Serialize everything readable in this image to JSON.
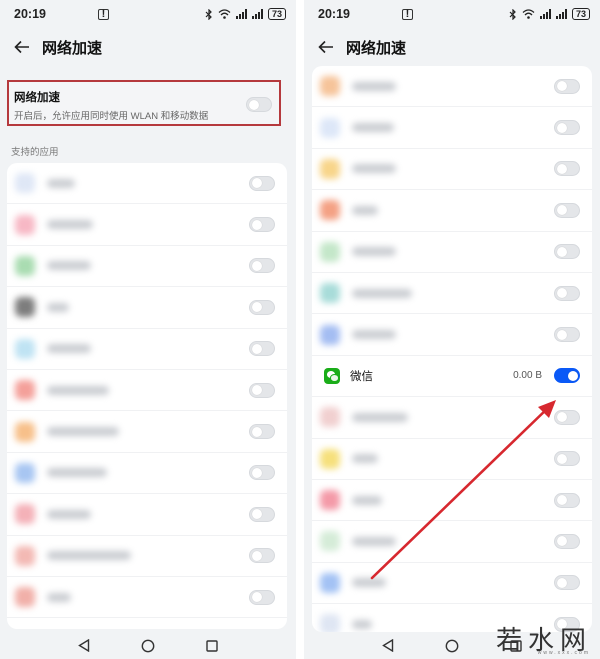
{
  "status_bar": {
    "time": "20:19",
    "battery": "73"
  },
  "screen_title": "网络加速",
  "accel_card": {
    "title": "网络加速",
    "subtitle": "开启后，允许应用同时使用 WLAN 和移动数据"
  },
  "section_label": "支持的应用",
  "left_apps": [
    {
      "icon_color": "#dfe7f6",
      "name_width": 28
    },
    {
      "icon_color": "#f7b8c5",
      "name_width": 46
    },
    {
      "icon_color": "#a9dcb1",
      "name_width": 44
    },
    {
      "icon_color": "#7d7d7d",
      "name_width": 22
    },
    {
      "icon_color": "#bfe3f3",
      "name_width": 44
    },
    {
      "icon_color": "#f4a09a",
      "name_width": 62
    },
    {
      "icon_color": "#f7c08a",
      "name_width": 72
    },
    {
      "icon_color": "#a8c6f2",
      "name_width": 60
    },
    {
      "icon_color": "#f4b1b8",
      "name_width": 44
    },
    {
      "icon_color": "#f3b9b4",
      "name_width": 84
    },
    {
      "icon_color": "#f1b0a9",
      "name_width": 24
    }
  ],
  "right_apps": [
    {
      "icon_color": "#f6c49a",
      "name_width": 44
    },
    {
      "icon_color": "#dde7f8",
      "name_width": 42
    },
    {
      "icon_color": "#f8d58a",
      "name_width": 44
    },
    {
      "icon_color": "#f4a184",
      "name_width": 26
    },
    {
      "icon_color": "#c4e7c9",
      "name_width": 44
    },
    {
      "icon_color": "#a8dcd9",
      "name_width": 60
    },
    {
      "icon_color": "#a4bdf2",
      "name_width": 44
    }
  ],
  "wechat_row": {
    "name": "微信",
    "size": "0.00 B",
    "enabled": true
  },
  "right_apps_after": [
    {
      "icon_color": "#f1d0d0",
      "name_width": 56
    },
    {
      "icon_color": "#f6e07c",
      "name_width": 26
    },
    {
      "icon_color": "#f49aa8",
      "name_width": 30
    },
    {
      "icon_color": "#d5ecd8",
      "name_width": 44
    },
    {
      "icon_color": "#a3c2f4",
      "name_width": 34
    },
    {
      "icon_color": "#dfe6f3",
      "name_width": 20
    }
  ],
  "colors": {
    "accent": "#0a59f7",
    "highlight_border": "#b5393d",
    "arrow": "#d7282f"
  },
  "watermark": {
    "text": "若水网",
    "sub": "www.xxx.com"
  }
}
